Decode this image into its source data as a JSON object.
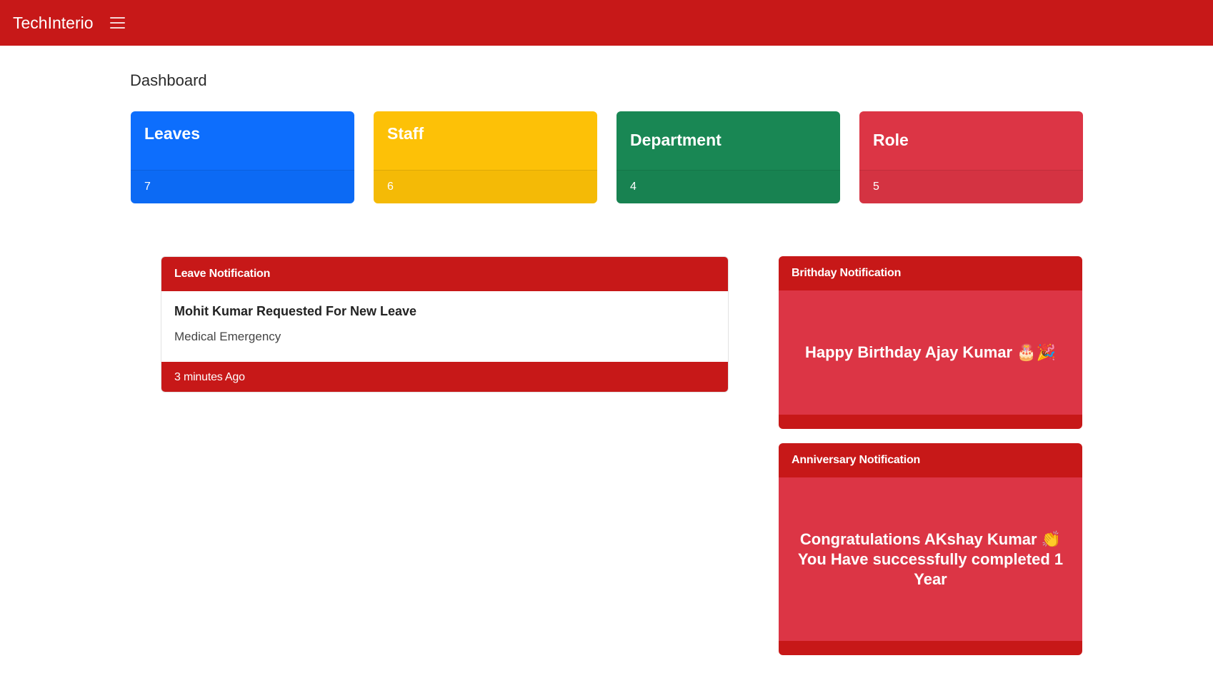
{
  "app": {
    "brand": "TechInterio",
    "menu_icon": "hamburger-menu-icon"
  },
  "page": {
    "title": "Dashboard"
  },
  "colors": {
    "topbar": "#c71818",
    "leaves": "#0d6efd",
    "staff": "#fdc107",
    "department": "#198754",
    "role": "#dc3545",
    "notification_header": "#c71818",
    "notification_body": "#dc3545"
  },
  "stats": [
    {
      "label": "Leaves",
      "value": "7"
    },
    {
      "label": "Staff",
      "value": "6"
    },
    {
      "label": "Department",
      "value": "4"
    },
    {
      "label": "Role",
      "value": "5"
    }
  ],
  "leave_notification": {
    "header": "Leave Notification",
    "heading": "Mohit Kumar Requested For New Leave",
    "reason": "Medical Emergency",
    "time": "3 minutes Ago"
  },
  "birthday_notification": {
    "header": "Brithday Notification",
    "message": "Happy Birthday Ajay Kumar 🎂🎉"
  },
  "anniversary_notification": {
    "header": "Anniversary Notification",
    "message": "Congratulations AKshay Kumar 👏 You Have successfully completed 1 Year"
  }
}
